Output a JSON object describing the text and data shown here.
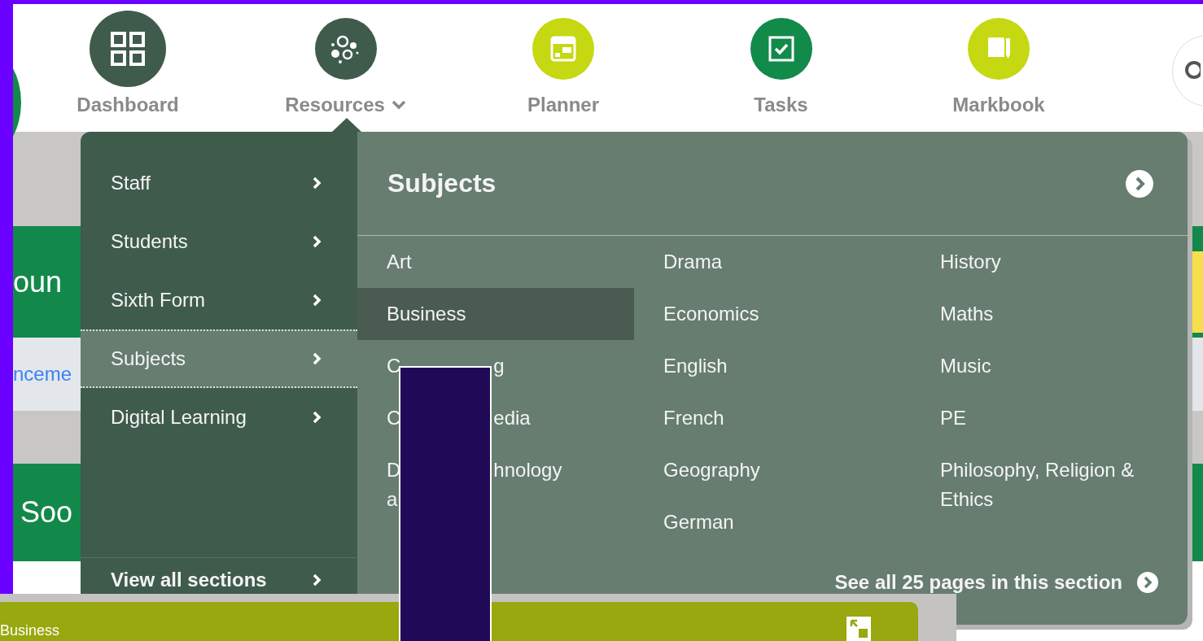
{
  "nav": [
    {
      "label": "Dashboard",
      "kind": "grid",
      "color": "#3f5b4c",
      "hovered": true,
      "expanded": false
    },
    {
      "label": "Resources",
      "kind": "bubbles",
      "color": "#3f5b4c",
      "hovered": false,
      "expanded": true
    },
    {
      "label": "Planner",
      "kind": "planner",
      "color": "#c5d812",
      "hovered": false,
      "expanded": false
    },
    {
      "label": "Tasks",
      "kind": "tasks",
      "color": "#128a4a",
      "hovered": false,
      "expanded": false
    },
    {
      "label": "Markbook",
      "kind": "book",
      "color": "#c5d812",
      "hovered": false,
      "expanded": false
    }
  ],
  "backdrop": {
    "banner_1": "oun",
    "link": "nceme",
    "banner_2": "Soo"
  },
  "menu": {
    "sections": [
      {
        "label": "Staff",
        "selected": false
      },
      {
        "label": "Students",
        "selected": false
      },
      {
        "label": "Sixth Form",
        "selected": false
      },
      {
        "label": "Subjects",
        "selected": true
      },
      {
        "label": "Digital Learning",
        "selected": false
      }
    ],
    "view_all": "View all sections",
    "panel": {
      "title": "Subjects",
      "columns": [
        [
          {
            "label": "Art",
            "selected": false
          },
          {
            "label": "Business",
            "selected": true
          },
          {
            "lines": [
              [
                "C",
                "g"
              ]
            ],
            "selected": false
          },
          {
            "lines": [
              [
                "C",
                "edia"
              ]
            ],
            "selected": false
          },
          {
            "lines": [
              [
                "D",
                "hnology"
              ],
              [
                "a"
              ]
            ],
            "selected": false
          }
        ],
        [
          {
            "label": "Drama",
            "selected": false
          },
          {
            "label": "Economics",
            "selected": false
          },
          {
            "label": "English",
            "selected": false
          },
          {
            "label": "French",
            "selected": false
          },
          {
            "label": "Geography",
            "selected": false
          },
          {
            "label": "German",
            "selected": false
          }
        ],
        [
          {
            "label": "History",
            "selected": false
          },
          {
            "label": "Maths",
            "selected": false
          },
          {
            "label": "Music",
            "selected": false
          },
          {
            "label": "PE",
            "selected": false
          },
          {
            "label": "Philosophy, Religion & Ethics",
            "selected": false
          }
        ]
      ],
      "see_all": "See all 25 pages in this section"
    }
  },
  "bottom_bar": {
    "title": "Business"
  }
}
